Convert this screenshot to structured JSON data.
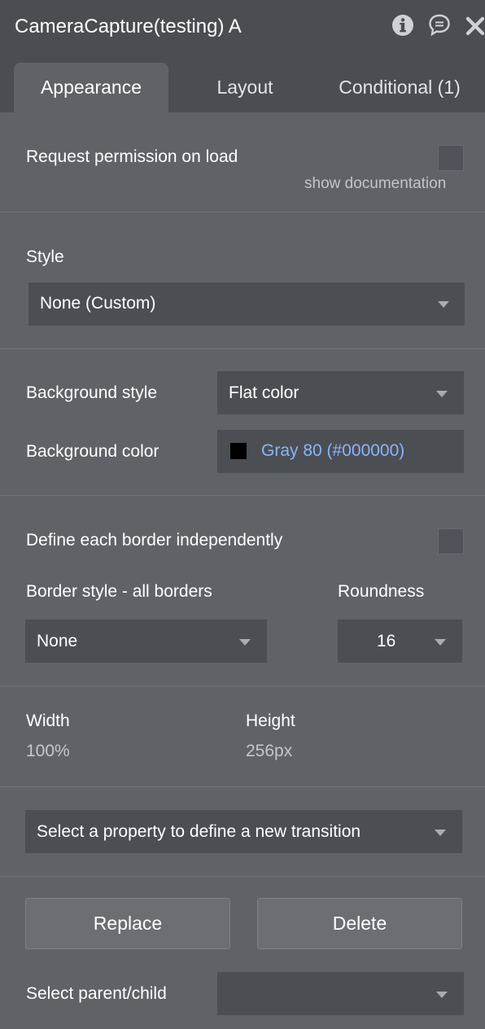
{
  "header": {
    "title": "CameraCapture(testing) A",
    "icons": [
      "info-icon",
      "comment-icon",
      "close-icon"
    ]
  },
  "tabs": [
    {
      "label": "Appearance",
      "active": true
    },
    {
      "label": "Layout",
      "active": false
    },
    {
      "label": "Conditional (1)",
      "active": false
    }
  ],
  "permission": {
    "label": "Request permission on load",
    "checked": false,
    "doc_link": "show documentation"
  },
  "style": {
    "label": "Style",
    "value": "None (Custom)"
  },
  "background": {
    "style_label": "Background style",
    "style_value": "Flat color",
    "color_label": "Background color",
    "color_value": "Gray 80 (#000000)",
    "swatch_color": "#000000"
  },
  "border": {
    "independent_label": "Define each border independently",
    "independent_checked": false,
    "style_label": "Border style - all borders",
    "style_value": "None",
    "roundness_label": "Roundness",
    "roundness_value": "16"
  },
  "size": {
    "width_label": "Width",
    "width_value": "100%",
    "height_label": "Height",
    "height_value": "256px"
  },
  "transition": {
    "placeholder": "Select a property to define a new transition"
  },
  "actions": {
    "replace_label": "Replace",
    "delete_label": "Delete"
  },
  "parent_child": {
    "label": "Select parent/child",
    "value": ""
  },
  "colors": {
    "panel_bg": "#5f6368",
    "header_bg": "#4a4d52",
    "field_bg": "#4b4f54",
    "link_blue": "#8ab4f8"
  }
}
